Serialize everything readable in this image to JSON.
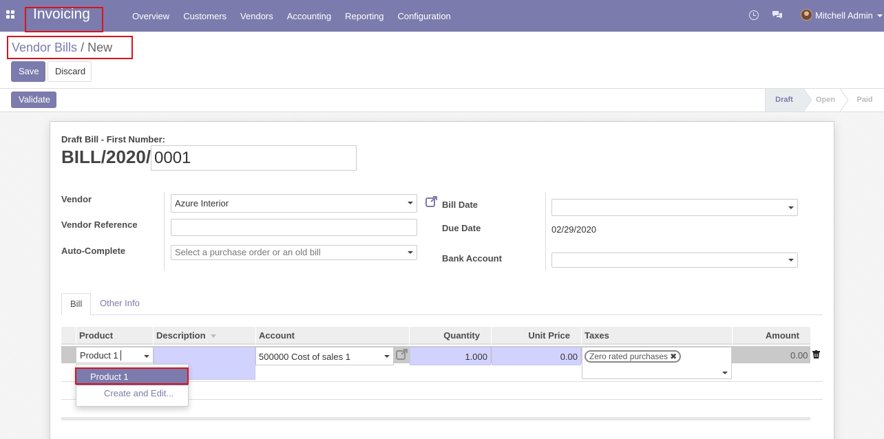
{
  "navbar": {
    "app_name": "Invoicing",
    "menu": [
      "Overview",
      "Customers",
      "Vendors",
      "Accounting",
      "Reporting",
      "Configuration"
    ],
    "user_name": "Mitchell Admin",
    "icons": [
      "apps-icon",
      "clock-icon",
      "chat-icon"
    ]
  },
  "breadcrumb": {
    "parent": "Vendor Bills",
    "separator": "/",
    "current": "New"
  },
  "buttons": {
    "save": "Save",
    "discard": "Discard",
    "validate": "Validate"
  },
  "statusbar": {
    "states": [
      "Draft",
      "Open",
      "Paid"
    ],
    "active": "Draft"
  },
  "form": {
    "draft_label": "Draft Bill  - First Number:",
    "bill_prefix": "BILL/2020/",
    "bill_number": "0001",
    "vendor_label": "Vendor",
    "vendor_value": "Azure Interior",
    "vendor_reference_label": "Vendor Reference",
    "vendor_reference_value": "",
    "auto_complete_label": "Auto-Complete",
    "auto_complete_placeholder": "Select a purchase order or an old bill",
    "bill_date_label": "Bill Date",
    "bill_date_value": "",
    "due_date_label": "Due Date",
    "due_date_value": "02/29/2020",
    "bank_account_label": "Bank Account",
    "bank_account_value": ""
  },
  "tabs": [
    "Bill",
    "Other Info"
  ],
  "table": {
    "headers": [
      "Product",
      "Description",
      "Account",
      "Quantity",
      "Unit Price",
      "Taxes",
      "Amount"
    ],
    "row": {
      "product": "Product 1",
      "description": "",
      "account": "500000 Cost of sales 1",
      "quantity": "1.000",
      "unit_price": "0.00",
      "tax": "Zero rated purchases",
      "tax_remove": "✖",
      "amount": "0.00"
    }
  },
  "dropdown": {
    "option": "Product 1",
    "create_edit": "Create and Edit..."
  },
  "colors": {
    "brand": "#7c7bad",
    "highlight": "#d9131c",
    "editable_cell": "#d2d2ff"
  }
}
